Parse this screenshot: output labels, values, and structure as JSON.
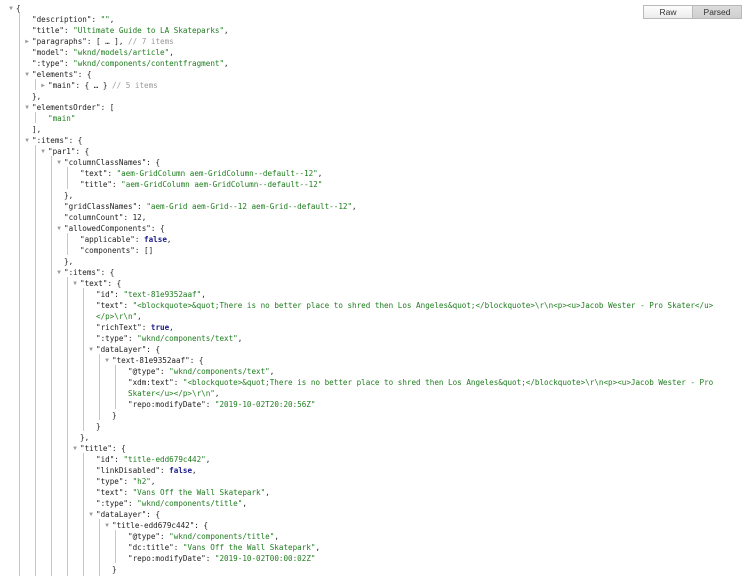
{
  "tabs": {
    "raw": "Raw",
    "parsed": "Parsed",
    "active": "parsed"
  },
  "lines": [
    {
      "indent": 0,
      "tog": "open",
      "parts": [
        [
          "p",
          "{"
        ]
      ]
    },
    {
      "indent": 1,
      "parts": [
        [
          "k",
          "\"description\""
        ],
        [
          "p",
          ": "
        ],
        [
          "s",
          "\"\""
        ],
        [
          "p",
          ","
        ]
      ]
    },
    {
      "indent": 1,
      "parts": [
        [
          "k",
          "\"title\""
        ],
        [
          "p",
          ": "
        ],
        [
          "s",
          "\"Ultimate Guide to LA Skateparks\""
        ],
        [
          "p",
          ","
        ]
      ]
    },
    {
      "indent": 1,
      "tog": "closed",
      "parts": [
        [
          "k",
          "\"paragraphs\""
        ],
        [
          "p",
          ": [ … ], "
        ],
        [
          "c",
          "// 7 items"
        ]
      ]
    },
    {
      "indent": 1,
      "parts": [
        [
          "k",
          "\"model\""
        ],
        [
          "p",
          ": "
        ],
        [
          "s",
          "\"wknd/models/article\""
        ],
        [
          "p",
          ","
        ]
      ]
    },
    {
      "indent": 1,
      "parts": [
        [
          "k",
          "\":type\""
        ],
        [
          "p",
          ": "
        ],
        [
          "s",
          "\"wknd/components/contentfragment\""
        ],
        [
          "p",
          ","
        ]
      ]
    },
    {
      "indent": 1,
      "tog": "open",
      "parts": [
        [
          "k",
          "\"elements\""
        ],
        [
          "p",
          ": {"
        ]
      ]
    },
    {
      "indent": 2,
      "tog": "closed",
      "parts": [
        [
          "k",
          "\"main\""
        ],
        [
          "p",
          ": { … } "
        ],
        [
          "c",
          "// 5 items"
        ]
      ]
    },
    {
      "indent": 1,
      "parts": [
        [
          "p",
          "},"
        ]
      ]
    },
    {
      "indent": 1,
      "tog": "open",
      "parts": [
        [
          "k",
          "\"elementsOrder\""
        ],
        [
          "p",
          ": ["
        ]
      ]
    },
    {
      "indent": 2,
      "parts": [
        [
          "s",
          "\"main\""
        ]
      ]
    },
    {
      "indent": 1,
      "parts": [
        [
          "p",
          "],"
        ]
      ]
    },
    {
      "indent": 1,
      "tog": "open",
      "parts": [
        [
          "k",
          "\":items\""
        ],
        [
          "p",
          ": {"
        ]
      ]
    },
    {
      "indent": 2,
      "tog": "open",
      "parts": [
        [
          "k",
          "\"par1\""
        ],
        [
          "p",
          ": {"
        ]
      ]
    },
    {
      "indent": 3,
      "tog": "open",
      "parts": [
        [
          "k",
          "\"columnClassNames\""
        ],
        [
          "p",
          ": {"
        ]
      ]
    },
    {
      "indent": 4,
      "parts": [
        [
          "k",
          "\"text\""
        ],
        [
          "p",
          ": "
        ],
        [
          "s",
          "\"aem-GridColumn aem-GridColumn--default--12\""
        ],
        [
          "p",
          ","
        ]
      ]
    },
    {
      "indent": 4,
      "parts": [
        [
          "k",
          "\"title\""
        ],
        [
          "p",
          ": "
        ],
        [
          "s",
          "\"aem-GridColumn aem-GridColumn--default--12\""
        ]
      ]
    },
    {
      "indent": 3,
      "parts": [
        [
          "p",
          "},"
        ]
      ]
    },
    {
      "indent": 3,
      "parts": [
        [
          "k",
          "\"gridClassNames\""
        ],
        [
          "p",
          ": "
        ],
        [
          "s",
          "\"aem-Grid aem-Grid--12 aem-Grid--default--12\""
        ],
        [
          "p",
          ","
        ]
      ]
    },
    {
      "indent": 3,
      "parts": [
        [
          "k",
          "\"columnCount\""
        ],
        [
          "p",
          ": "
        ],
        [
          "n",
          "12"
        ],
        [
          "p",
          ","
        ]
      ]
    },
    {
      "indent": 3,
      "tog": "open",
      "parts": [
        [
          "k",
          "\"allowedComponents\""
        ],
        [
          "p",
          ": {"
        ]
      ]
    },
    {
      "indent": 4,
      "parts": [
        [
          "k",
          "\"applicable\""
        ],
        [
          "p",
          ": "
        ],
        [
          "b",
          "false"
        ],
        [
          "p",
          ","
        ]
      ]
    },
    {
      "indent": 4,
      "parts": [
        [
          "k",
          "\"components\""
        ],
        [
          "p",
          ": []"
        ]
      ]
    },
    {
      "indent": 3,
      "parts": [
        [
          "p",
          "},"
        ]
      ]
    },
    {
      "indent": 3,
      "tog": "open",
      "parts": [
        [
          "k",
          "\":items\""
        ],
        [
          "p",
          ": {"
        ]
      ]
    },
    {
      "indent": 4,
      "tog": "open",
      "parts": [
        [
          "k",
          "\"text\""
        ],
        [
          "p",
          ": {"
        ]
      ]
    },
    {
      "indent": 5,
      "parts": [
        [
          "k",
          "\"id\""
        ],
        [
          "p",
          ": "
        ],
        [
          "s",
          "\"text-81e9352aaf\""
        ],
        [
          "p",
          ","
        ]
      ]
    },
    {
      "indent": 5,
      "parts": [
        [
          "k",
          "\"text\""
        ],
        [
          "p",
          ": "
        ],
        [
          "s",
          "\"<blockquote>&quot;There is no better place to shred then Los Angeles&quot;</blockquote>\\r\\n<p><u>Jacob Wester - Pro Skater</u>"
        ]
      ]
    },
    {
      "indent": 5,
      "parts": [
        [
          "s",
          "</p>\\r\\n\""
        ],
        [
          "p",
          ","
        ]
      ]
    },
    {
      "indent": 5,
      "parts": [
        [
          "k",
          "\"richText\""
        ],
        [
          "p",
          ": "
        ],
        [
          "b",
          "true"
        ],
        [
          "p",
          ","
        ]
      ]
    },
    {
      "indent": 5,
      "parts": [
        [
          "k",
          "\":type\""
        ],
        [
          "p",
          ": "
        ],
        [
          "s",
          "\"wknd/components/text\""
        ],
        [
          "p",
          ","
        ]
      ]
    },
    {
      "indent": 5,
      "tog": "open",
      "parts": [
        [
          "k",
          "\"dataLayer\""
        ],
        [
          "p",
          ": {"
        ]
      ]
    },
    {
      "indent": 6,
      "tog": "open",
      "parts": [
        [
          "k",
          "\"text-81e9352aaf\""
        ],
        [
          "p",
          ": {"
        ]
      ]
    },
    {
      "indent": 7,
      "parts": [
        [
          "k",
          "\"@type\""
        ],
        [
          "p",
          ": "
        ],
        [
          "s",
          "\"wknd/components/text\""
        ],
        [
          "p",
          ","
        ]
      ]
    },
    {
      "indent": 7,
      "parts": [
        [
          "k",
          "\"xdm:text\""
        ],
        [
          "p",
          ": "
        ],
        [
          "s",
          "\"<blockquote>&quot;There is no better place to shred then Los Angeles&quot;</blockquote>\\r\\n<p><u>Jacob Wester - Pro"
        ]
      ]
    },
    {
      "indent": 7,
      "parts": [
        [
          "s",
          "Skater</u></p>\\r\\n\""
        ],
        [
          "p",
          ","
        ]
      ]
    },
    {
      "indent": 7,
      "parts": [
        [
          "k",
          "\"repo:modifyDate\""
        ],
        [
          "p",
          ": "
        ],
        [
          "s",
          "\"2019-10-02T20:20:56Z\""
        ]
      ]
    },
    {
      "indent": 6,
      "parts": [
        [
          "p",
          "}"
        ]
      ]
    },
    {
      "indent": 5,
      "parts": [
        [
          "p",
          "}"
        ]
      ]
    },
    {
      "indent": 4,
      "parts": [
        [
          "p",
          "},"
        ]
      ]
    },
    {
      "indent": 4,
      "tog": "open",
      "parts": [
        [
          "k",
          "\"title\""
        ],
        [
          "p",
          ": {"
        ]
      ]
    },
    {
      "indent": 5,
      "parts": [
        [
          "k",
          "\"id\""
        ],
        [
          "p",
          ": "
        ],
        [
          "s",
          "\"title-edd679c442\""
        ],
        [
          "p",
          ","
        ]
      ]
    },
    {
      "indent": 5,
      "parts": [
        [
          "k",
          "\"linkDisabled\""
        ],
        [
          "p",
          ": "
        ],
        [
          "b",
          "false"
        ],
        [
          "p",
          ","
        ]
      ]
    },
    {
      "indent": 5,
      "parts": [
        [
          "k",
          "\"type\""
        ],
        [
          "p",
          ": "
        ],
        [
          "s",
          "\"h2\""
        ],
        [
          "p",
          ","
        ]
      ]
    },
    {
      "indent": 5,
      "parts": [
        [
          "k",
          "\"text\""
        ],
        [
          "p",
          ": "
        ],
        [
          "s",
          "\"Vans Off the Wall Skatepark\""
        ],
        [
          "p",
          ","
        ]
      ]
    },
    {
      "indent": 5,
      "parts": [
        [
          "k",
          "\":type\""
        ],
        [
          "p",
          ": "
        ],
        [
          "s",
          "\"wknd/components/title\""
        ],
        [
          "p",
          ","
        ]
      ]
    },
    {
      "indent": 5,
      "tog": "open",
      "parts": [
        [
          "k",
          "\"dataLayer\""
        ],
        [
          "p",
          ": {"
        ]
      ]
    },
    {
      "indent": 6,
      "tog": "open",
      "parts": [
        [
          "k",
          "\"title-edd679c442\""
        ],
        [
          "p",
          ": {"
        ]
      ]
    },
    {
      "indent": 7,
      "parts": [
        [
          "k",
          "\"@type\""
        ],
        [
          "p",
          ": "
        ],
        [
          "s",
          "\"wknd/components/title\""
        ],
        [
          "p",
          ","
        ]
      ]
    },
    {
      "indent": 7,
      "parts": [
        [
          "k",
          "\"dc:title\""
        ],
        [
          "p",
          ": "
        ],
        [
          "s",
          "\"Vans Off the Wall Skatepark\""
        ],
        [
          "p",
          ","
        ]
      ]
    },
    {
      "indent": 7,
      "parts": [
        [
          "k",
          "\"repo:modifyDate\""
        ],
        [
          "p",
          ": "
        ],
        [
          "s",
          "\"2019-10-02T00:00:02Z\""
        ]
      ]
    },
    {
      "indent": 6,
      "parts": [
        [
          "p",
          "}"
        ]
      ]
    }
  ]
}
